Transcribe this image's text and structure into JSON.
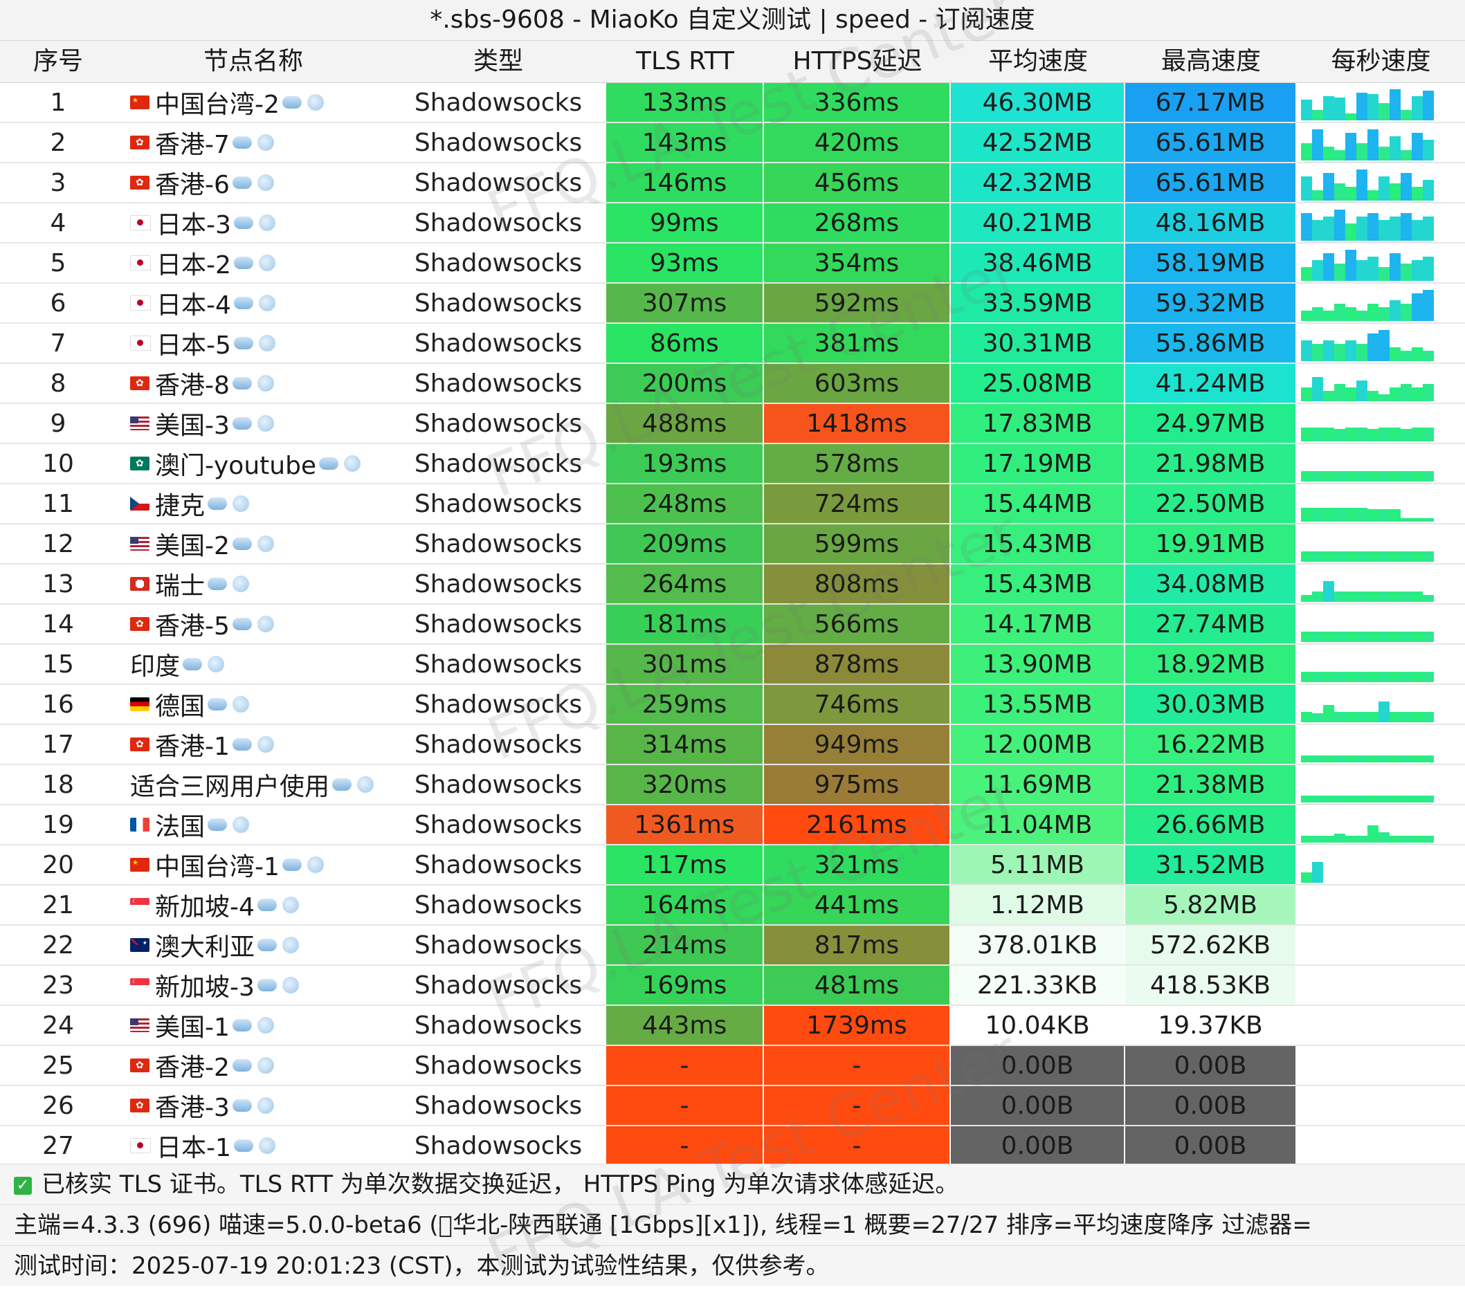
{
  "window": {
    "title": "*.sbs-9608 - MiaoKo 自定义测试 | speed - 订阅速度"
  },
  "columns": [
    "序号",
    "节点名称",
    "类型",
    "TLS RTT",
    "HTTPS延迟",
    "平均速度",
    "最高速度",
    "每秒速度"
  ],
  "watermark": [
    "FFQ.LA Test Center",
    "FFQ.LA Test Center",
    "FFQ.LA Test Center",
    "FFQ.LA Test Center",
    "FFQ.LA Test Center",
    "FFQ.LA Test Center"
  ],
  "rows": [
    {
      "idx": "1",
      "flag": "cn",
      "name": "中国台湾-2",
      "type": "Shadowsocks",
      "tls": "133ms",
      "https": "336ms",
      "avg": "46.30MB",
      "max": "67.17MB",
      "tls_color": "#2fdc60",
      "https_color": "#2fdc60",
      "avg_color": "#1de3d3",
      "max_color": "#1aa0f2",
      "graph": [
        0.6,
        0.3,
        0.7,
        0.65,
        0.2,
        0.8,
        0.75,
        0.5,
        0.9,
        0.3,
        0.7,
        0.85
      ]
    },
    {
      "idx": "2",
      "flag": "hk",
      "name": "香港-7",
      "type": "Shadowsocks",
      "tls": "143ms",
      "https": "420ms",
      "avg": "42.52MB",
      "max": "65.61MB",
      "tls_color": "#2fdc60",
      "https_color": "#33d95a",
      "avg_color": "#1de6c8",
      "max_color": "#1aa8f0",
      "graph": [
        0.5,
        0.9,
        0.4,
        0.3,
        0.8,
        0.5,
        0.9,
        0.4,
        0.7,
        0.3,
        0.8,
        0.6
      ]
    },
    {
      "idx": "3",
      "flag": "hk",
      "name": "香港-6",
      "type": "Shadowsocks",
      "tls": "146ms",
      "https": "456ms",
      "avg": "42.32MB",
      "max": "65.61MB",
      "tls_color": "#2fdc60",
      "https_color": "#37d558",
      "avg_color": "#1de6c8",
      "max_color": "#1aa8f0",
      "graph": [
        0.7,
        0.3,
        0.8,
        0.5,
        0.4,
        0.9,
        0.3,
        0.7,
        0.5,
        0.8,
        0.4,
        0.6
      ]
    },
    {
      "idx": "4",
      "flag": "jp",
      "name": "日本-3",
      "type": "Shadowsocks",
      "tls": "99ms",
      "https": "268ms",
      "avg": "40.21MB",
      "max": "48.16MB",
      "tls_color": "#2ae463",
      "https_color": "#2fdc60",
      "avg_color": "#1de8bf",
      "max_color": "#1bcfe0",
      "graph": [
        0.8,
        0.6,
        0.7,
        0.9,
        0.5,
        0.7,
        0.8,
        0.6,
        0.7,
        0.8,
        0.6,
        0.7
      ]
    },
    {
      "idx": "5",
      "flag": "jp",
      "name": "日本-2",
      "type": "Shadowsocks",
      "tls": "93ms",
      "https": "354ms",
      "avg": "38.46MB",
      "max": "58.19MB",
      "tls_color": "#2ae463",
      "https_color": "#33d95a",
      "avg_color": "#1de9b6",
      "max_color": "#1ab4ee",
      "graph": [
        0.4,
        0.6,
        0.8,
        0.5,
        0.9,
        0.6,
        0.7,
        0.4,
        0.8,
        0.5,
        0.6,
        0.7
      ]
    },
    {
      "idx": "6",
      "flag": "jp",
      "name": "日本-4",
      "type": "Shadowsocks",
      "tls": "307ms",
      "https": "592ms",
      "avg": "33.59MB",
      "max": "59.32MB",
      "tls_color": "#56b84a",
      "https_color": "#6aa743",
      "avg_color": "#1eeaa6",
      "max_color": "#1ab2ef",
      "graph": [
        0.3,
        0.4,
        0.3,
        0.5,
        0.4,
        0.3,
        0.5,
        0.4,
        0.6,
        0.5,
        0.8,
        0.9
      ]
    },
    {
      "idx": "7",
      "flag": "jp",
      "name": "日本-5",
      "type": "Shadowsocks",
      "tls": "86ms",
      "https": "381ms",
      "avg": "30.31MB",
      "max": "55.86MB",
      "tls_color": "#2ae463",
      "https_color": "#33d95a",
      "avg_color": "#20eb9b",
      "max_color": "#1ab8ed",
      "graph": [
        0.6,
        0.5,
        0.6,
        0.5,
        0.6,
        0.5,
        0.8,
        0.9,
        0.4,
        0.3,
        0.4,
        0.3
      ]
    },
    {
      "idx": "8",
      "flag": "hk",
      "name": "香港-8",
      "type": "Shadowsocks",
      "tls": "200ms",
      "https": "603ms",
      "avg": "25.08MB",
      "max": "41.24MB",
      "tls_color": "#3ccb55",
      "https_color": "#6aa743",
      "avg_color": "#22ec8c",
      "max_color": "#1ce3cf",
      "graph": [
        0.4,
        0.7,
        0.3,
        0.5,
        0.4,
        0.6,
        0.3,
        0.2,
        0.4,
        0.5,
        0.4,
        0.5
      ]
    },
    {
      "idx": "9",
      "flag": "us",
      "name": "美国-3",
      "type": "Shadowsocks",
      "tls": "488ms",
      "https": "1418ms",
      "avg": "17.83MB",
      "max": "24.97MB",
      "tls_color": "#6aa743",
      "https_color": "#f6541c",
      "avg_color": "#30ee7e",
      "max_color": "#22ec8c",
      "graph": [
        0.4,
        0.4,
        0.4,
        0.35,
        0.4,
        0.4,
        0.35,
        0.4,
        0.4,
        0.35,
        0.4,
        0.4
      ]
    },
    {
      "idx": "10",
      "flag": "mo",
      "name": "澳门-youtube",
      "type": "Shadowsocks",
      "tls": "193ms",
      "https": "578ms",
      "avg": "17.19MB",
      "max": "21.98MB",
      "tls_color": "#3ccb55",
      "https_color": "#64ad45",
      "avg_color": "#30ee7e",
      "max_color": "#28ed88",
      "graph": [
        0.3,
        0.3,
        0.3,
        0.3,
        0.3,
        0.3,
        0.3,
        0.3,
        0.3,
        0.3,
        0.3,
        0.3
      ]
    },
    {
      "idx": "11",
      "flag": "cz",
      "name": "捷克",
      "type": "Shadowsocks",
      "tls": "248ms",
      "https": "724ms",
      "avg": "15.44MB",
      "max": "22.50MB",
      "tls_color": "#4ec04e",
      "https_color": "#7a9a3e",
      "avg_color": "#36ef7c",
      "max_color": "#28ed88",
      "graph": [
        0.4,
        0.4,
        0.4,
        0.4,
        0.4,
        0.4,
        0.35,
        0.35,
        0.35,
        0.1,
        0.1,
        0.1
      ]
    },
    {
      "idx": "12",
      "flag": "us",
      "name": "美国-2",
      "type": "Shadowsocks",
      "tls": "209ms",
      "https": "599ms",
      "avg": "15.43MB",
      "max": "19.91MB",
      "tls_color": "#40c854",
      "https_color": "#6aa743",
      "avg_color": "#36ef7c",
      "max_color": "#2eee80",
      "graph": [
        0.3,
        0.3,
        0.3,
        0.3,
        0.3,
        0.3,
        0.3,
        0.3,
        0.3,
        0.3,
        0.3,
        0.3
      ]
    },
    {
      "idx": "13",
      "flag": "ch",
      "name": "瑞士",
      "type": "Shadowsocks",
      "tls": "264ms",
      "https": "808ms",
      "avg": "15.43MB",
      "max": "34.08MB",
      "tls_color": "#52bd4c",
      "https_color": "#84903b",
      "avg_color": "#36ef7c",
      "max_color": "#20eaa4",
      "graph": [
        0.2,
        0.3,
        0.6,
        0.3,
        0.3,
        0.3,
        0.3,
        0.3,
        0.3,
        0.3,
        0.3,
        0.2
      ]
    },
    {
      "idx": "14",
      "flag": "hk",
      "name": "香港-5",
      "type": "Shadowsocks",
      "tls": "181ms",
      "https": "566ms",
      "avg": "14.17MB",
      "max": "27.74MB",
      "tls_color": "#38cf57",
      "https_color": "#64ad45",
      "avg_color": "#3cf07a",
      "max_color": "#24ec8f",
      "graph": [
        0.3,
        0.3,
        0.3,
        0.3,
        0.3,
        0.3,
        0.3,
        0.3,
        0.3,
        0.3,
        0.3,
        0.3
      ]
    },
    {
      "idx": "15",
      "flag": "none",
      "name": "印度",
      "type": "Shadowsocks",
      "tls": "301ms",
      "https": "878ms",
      "avg": "13.90MB",
      "max": "18.92MB",
      "tls_color": "#56b84a",
      "https_color": "#8c8a39",
      "avg_color": "#3cf07a",
      "max_color": "#30ee7e",
      "graph": [
        0.3,
        0.3,
        0.3,
        0.3,
        0.3,
        0.3,
        0.3,
        0.3,
        0.3,
        0.3,
        0.3,
        0.3
      ]
    },
    {
      "idx": "16",
      "flag": "de",
      "name": "德国",
      "type": "Shadowsocks",
      "tls": "259ms",
      "https": "746ms",
      "avg": "13.55MB",
      "max": "30.03MB",
      "tls_color": "#52bd4c",
      "https_color": "#7e983d",
      "avg_color": "#3cf07a",
      "max_color": "#22eb99",
      "graph": [
        0.3,
        0.25,
        0.5,
        0.3,
        0.3,
        0.3,
        0.3,
        0.6,
        0.3,
        0.3,
        0.3,
        0.3
      ]
    },
    {
      "idx": "17",
      "flag": "hk",
      "name": "香港-1",
      "type": "Shadowsocks",
      "tls": "314ms",
      "https": "949ms",
      "avg": "12.00MB",
      "max": "16.22MB",
      "tls_color": "#58b649",
      "https_color": "#968038",
      "avg_color": "#44f17a",
      "max_color": "#36ef7c",
      "graph": [
        0.2,
        0.2,
        0.2,
        0.2,
        0.2,
        0.2,
        0.2,
        0.2,
        0.2,
        0.2,
        0.2,
        0.2
      ]
    },
    {
      "idx": "18",
      "flag": "none",
      "name": "适合三网用户使用",
      "type": "Shadowsocks",
      "tls": "320ms",
      "https": "975ms",
      "avg": "11.69MB",
      "max": "21.38MB",
      "tls_color": "#58b649",
      "https_color": "#9a7c37",
      "avg_color": "#48f27b",
      "max_color": "#2eee80",
      "graph": [
        0.2,
        0.2,
        0.2,
        0.2,
        0.2,
        0.2,
        0.2,
        0.2,
        0.2,
        0.2,
        0.2,
        0.2
      ]
    },
    {
      "idx": "19",
      "flag": "fr",
      "name": "法国",
      "type": "Shadowsocks",
      "tls": "1361ms",
      "https": "2161ms",
      "avg": "11.04MB",
      "max": "26.66MB",
      "tls_color": "#f05a20",
      "https_color": "#ff4a10",
      "avg_color": "#4cf27c",
      "max_color": "#26ec8a",
      "graph": [
        0.2,
        0.2,
        0.2,
        0.25,
        0.2,
        0.2,
        0.5,
        0.3,
        0.2,
        0.2,
        0.2,
        0.2
      ]
    },
    {
      "idx": "20",
      "flag": "cn",
      "name": "中国台湾-1",
      "type": "Shadowsocks",
      "tls": "117ms",
      "https": "321ms",
      "avg": "5.11MB",
      "max": "31.52MB",
      "tls_color": "#2ae463",
      "https_color": "#2fdc60",
      "avg_color": "#9ef6b4",
      "max_color": "#22eb99",
      "graph": [
        0.3,
        0.6
      ]
    },
    {
      "idx": "21",
      "flag": "sg",
      "name": "新加坡-4",
      "type": "Shadowsocks",
      "tls": "164ms",
      "https": "441ms",
      "avg": "1.12MB",
      "max": "5.82MB",
      "tls_color": "#33d95a",
      "https_color": "#37d558",
      "avg_color": "#dffbe6",
      "max_color": "#a6f6bc",
      "graph": []
    },
    {
      "idx": "22",
      "flag": "au",
      "name": "澳大利亚",
      "type": "Shadowsocks",
      "tls": "214ms",
      "https": "817ms",
      "avg": "378.01KB",
      "max": "572.62KB",
      "tls_color": "#40c854",
      "https_color": "#86903b",
      "avg_color": "#f2fdf5",
      "max_color": "#e6fbec",
      "graph": []
    },
    {
      "idx": "23",
      "flag": "sg",
      "name": "新加坡-3",
      "type": "Shadowsocks",
      "tls": "169ms",
      "https": "481ms",
      "avg": "221.33KB",
      "max": "418.53KB",
      "tls_color": "#36d358",
      "https_color": "#3ccb55",
      "avg_color": "#f6fef8",
      "max_color": "#eafcef",
      "graph": []
    },
    {
      "idx": "24",
      "flag": "us",
      "name": "美国-1",
      "type": "Shadowsocks",
      "tls": "443ms",
      "https": "1739ms",
      "avg": "10.04KB",
      "max": "19.37KB",
      "tls_color": "#66ac45",
      "https_color": "#ff4a10",
      "avg_color": "#ffffff",
      "max_color": "#ffffff",
      "graph": []
    },
    {
      "idx": "25",
      "flag": "hk",
      "name": "香港-2",
      "type": "Shadowsocks",
      "tls": "-",
      "https": "-",
      "avg": "0.00B",
      "max": "0.00B",
      "tls_color": "#ff4a10",
      "https_color": "#ff4a10",
      "avg_color": "#646464",
      "max_color": "#646464",
      "graph": []
    },
    {
      "idx": "26",
      "flag": "hk",
      "name": "香港-3",
      "type": "Shadowsocks",
      "tls": "-",
      "https": "-",
      "avg": "0.00B",
      "max": "0.00B",
      "tls_color": "#ff4a10",
      "https_color": "#ff4a10",
      "avg_color": "#646464",
      "max_color": "#646464",
      "graph": []
    },
    {
      "idx": "27",
      "flag": "jp",
      "name": "日本-1",
      "type": "Shadowsocks",
      "tls": "-",
      "https": "-",
      "avg": "0.00B",
      "max": "0.00B",
      "tls_color": "#ff4a10",
      "https_color": "#ff4a10",
      "avg_color": "#646464",
      "max_color": "#646464",
      "graph": []
    }
  ],
  "footer": {
    "line1": "已核实 TLS 证书。TLS RTT 为单次数据交换延迟， HTTPS Ping 为单次请求体感延迟。",
    "line2": "主端=4.3.3 (696) 喵速=5.0.0-beta6 (⃝华北-陕西联通 [1Gbps][x1]), 线程=1 概要=27/27 排序=平均速度降序 过滤器=",
    "line3": "测试时间：2025-07-19 20:01:23 (CST)，本测试为试验性结果，仅供参考。"
  }
}
